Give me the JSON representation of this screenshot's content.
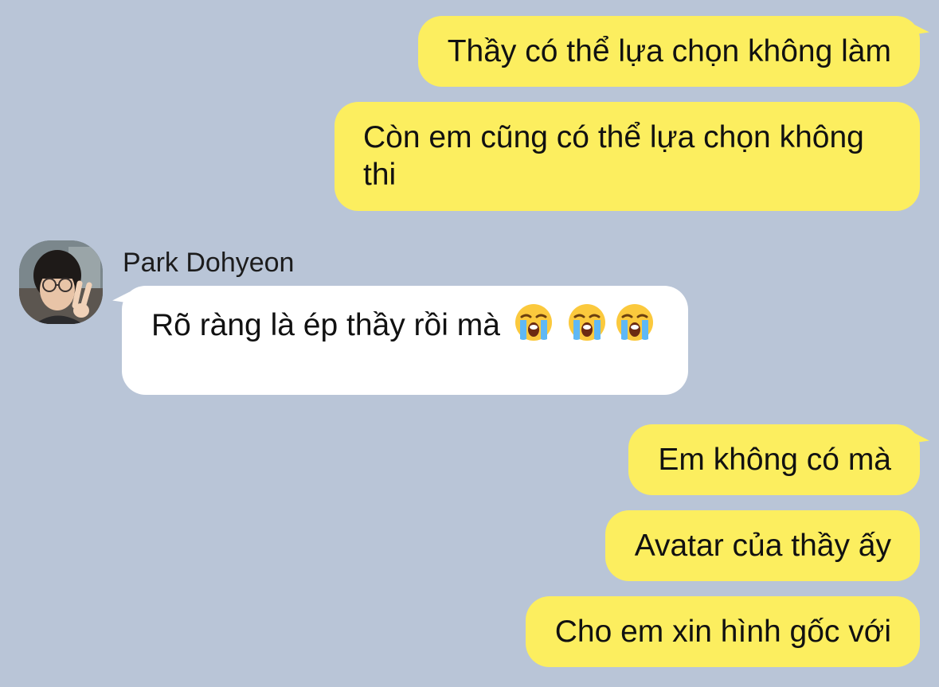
{
  "contact": {
    "name": "Park Dohyeon"
  },
  "messages": [
    {
      "from": "me",
      "text": "Thầy có thể lựa chọn không làm"
    },
    {
      "from": "me",
      "text": "Còn em cũng có thể lựa chọn không thi"
    },
    {
      "from": "them",
      "text": "Rõ ràng là ép thầy rồi mà",
      "emoji": [
        "loudly-crying-face",
        "loudly-crying-face",
        "loudly-crying-face"
      ]
    },
    {
      "from": "me",
      "text": "Em không có mà"
    },
    {
      "from": "me",
      "text": "Avatar của thầy ấy"
    },
    {
      "from": "me",
      "text": "Cho em xin hình gốc với"
    }
  ],
  "colors": {
    "background": "#b9c5d7",
    "my_bubble": "#fcee5f",
    "their_bubble": "#ffffff"
  }
}
